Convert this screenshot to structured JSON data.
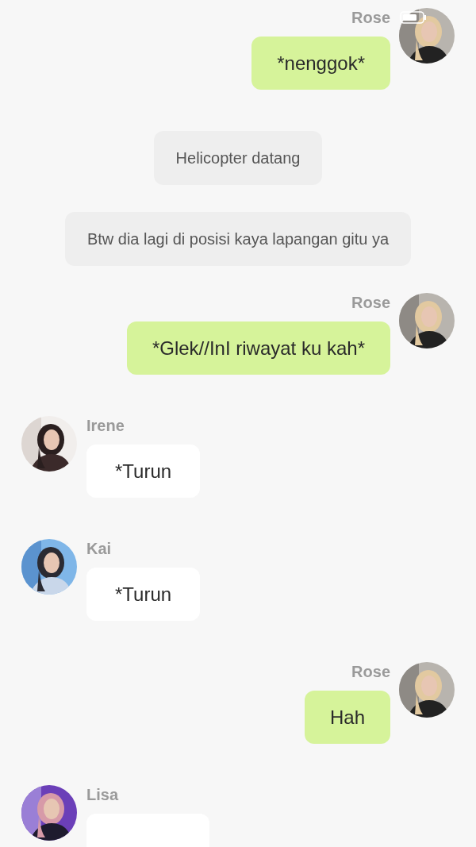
{
  "messages": [
    {
      "kind": "outgoing",
      "sender": "Rose",
      "text": "*nenggok*"
    },
    {
      "kind": "system",
      "text": "Helicopter datang"
    },
    {
      "kind": "system",
      "text": "Btw dia lagi di posisi kaya lapangan gitu ya"
    },
    {
      "kind": "outgoing",
      "sender": "Rose",
      "text": "*Glek//InI riwayat ku kah*"
    },
    {
      "kind": "incoming",
      "sender": "Irene",
      "text": "*Turun"
    },
    {
      "kind": "incoming",
      "sender": "Kai",
      "text": "*Turun"
    },
    {
      "kind": "outgoing",
      "sender": "Rose",
      "text": "Hah"
    },
    {
      "kind": "incoming",
      "sender": "Lisa"
    }
  ]
}
